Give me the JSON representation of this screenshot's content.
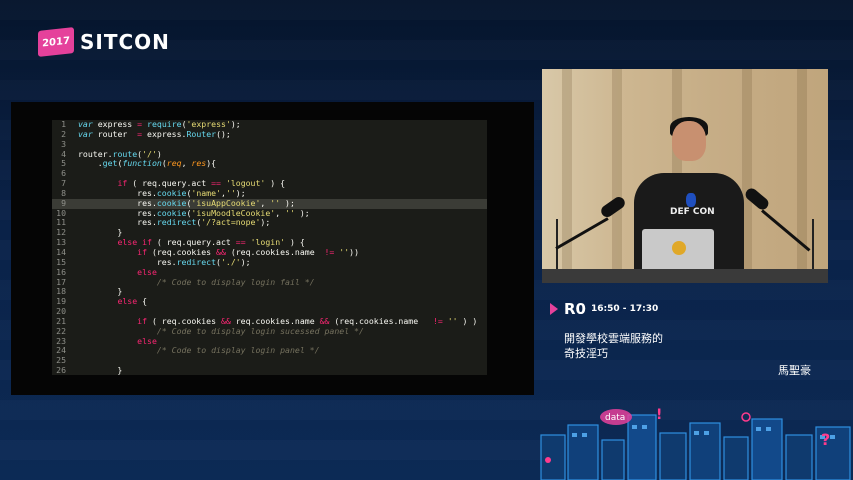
{
  "brand": {
    "year": "2017",
    "name": "SITCON"
  },
  "code": {
    "lines": [
      {
        "n": "1",
        "parts": [
          [
            "ky",
            "var"
          ],
          [
            "lt",
            " express "
          ],
          [
            "kw",
            "="
          ],
          [
            "lt",
            " "
          ],
          [
            "fn",
            "require"
          ],
          [
            "lt",
            "("
          ],
          [
            "st",
            "'express'"
          ],
          [
            "lt",
            ");"
          ]
        ]
      },
      {
        "n": "2",
        "parts": [
          [
            "ky",
            "var"
          ],
          [
            "lt",
            " router  "
          ],
          [
            "kw",
            "="
          ],
          [
            "lt",
            " express."
          ],
          [
            "fn",
            "Router"
          ],
          [
            "lt",
            "();"
          ]
        ]
      },
      {
        "n": "3",
        "parts": []
      },
      {
        "n": "4",
        "parts": [
          [
            "lt",
            "router."
          ],
          [
            "fn",
            "route"
          ],
          [
            "lt",
            "("
          ],
          [
            "st",
            "'/'"
          ],
          [
            "lt",
            ")"
          ]
        ]
      },
      {
        "n": "5",
        "parts": [
          [
            "lt",
            "    ."
          ],
          [
            "fn",
            "get"
          ],
          [
            "lt",
            "("
          ],
          [
            "ky",
            "function"
          ],
          [
            "lt",
            "("
          ],
          [
            "pa",
            "req"
          ],
          [
            "lt",
            ", "
          ],
          [
            "pa",
            "res"
          ],
          [
            "lt",
            "){"
          ]
        ]
      },
      {
        "n": "6",
        "parts": []
      },
      {
        "n": "7",
        "parts": [
          [
            "lt",
            "        "
          ],
          [
            "kw",
            "if"
          ],
          [
            "lt",
            " ( req.query.act "
          ],
          [
            "kw",
            "=="
          ],
          [
            "lt",
            " "
          ],
          [
            "st",
            "'logout'"
          ],
          [
            "lt",
            " ) {"
          ]
        ]
      },
      {
        "n": "8",
        "parts": [
          [
            "lt",
            "            res."
          ],
          [
            "fn",
            "cookie"
          ],
          [
            "lt",
            "("
          ],
          [
            "st",
            "'name'"
          ],
          [
            "lt",
            ","
          ],
          [
            "st",
            "''"
          ],
          [
            "lt",
            ");"
          ]
        ]
      },
      {
        "n": "9",
        "hl": true,
        "parts": [
          [
            "lt",
            "            res."
          ],
          [
            "fn",
            "cookie"
          ],
          [
            "lt",
            "("
          ],
          [
            "st",
            "'isuAppCookie'"
          ],
          [
            "lt",
            ", "
          ],
          [
            "st",
            "''"
          ],
          [
            "lt",
            " );"
          ]
        ]
      },
      {
        "n": "10",
        "parts": [
          [
            "lt",
            "            res."
          ],
          [
            "fn",
            "cookie"
          ],
          [
            "lt",
            "("
          ],
          [
            "st",
            "'isuMoodleCookie'"
          ],
          [
            "lt",
            ", "
          ],
          [
            "st",
            "''"
          ],
          [
            "lt",
            " );"
          ]
        ]
      },
      {
        "n": "11",
        "parts": [
          [
            "lt",
            "            res."
          ],
          [
            "fn",
            "redirect"
          ],
          [
            "lt",
            "("
          ],
          [
            "st",
            "'/?act=nope'"
          ],
          [
            "lt",
            ");"
          ]
        ]
      },
      {
        "n": "12",
        "parts": [
          [
            "lt",
            "        }"
          ]
        ]
      },
      {
        "n": "13",
        "parts": [
          [
            "lt",
            "        "
          ],
          [
            "kw",
            "else if"
          ],
          [
            "lt",
            " ( req.query.act "
          ],
          [
            "kw",
            "=="
          ],
          [
            "lt",
            " "
          ],
          [
            "st",
            "'login'"
          ],
          [
            "lt",
            " ) {"
          ]
        ]
      },
      {
        "n": "14",
        "parts": [
          [
            "lt",
            "            "
          ],
          [
            "kw",
            "if"
          ],
          [
            "lt",
            " (req.cookies "
          ],
          [
            "kw",
            "&&"
          ],
          [
            "lt",
            " (req.cookies.name  "
          ],
          [
            "kw",
            "!="
          ],
          [
            "lt",
            " "
          ],
          [
            "st",
            "''"
          ],
          [
            "lt",
            "))"
          ]
        ]
      },
      {
        "n": "15",
        "parts": [
          [
            "lt",
            "                res."
          ],
          [
            "fn",
            "redirect"
          ],
          [
            "lt",
            "("
          ],
          [
            "st",
            "'./'"
          ],
          [
            "lt",
            ");"
          ]
        ]
      },
      {
        "n": "16",
        "parts": [
          [
            "lt",
            "            "
          ],
          [
            "kw",
            "else"
          ]
        ]
      },
      {
        "n": "17",
        "parts": [
          [
            "lt",
            "                "
          ],
          [
            "cm",
            "/* Code to display login fail */"
          ]
        ]
      },
      {
        "n": "18",
        "parts": [
          [
            "lt",
            "        }"
          ]
        ]
      },
      {
        "n": "19",
        "parts": [
          [
            "lt",
            "        "
          ],
          [
            "kw",
            "else"
          ],
          [
            "lt",
            " {"
          ]
        ]
      },
      {
        "n": "20",
        "parts": []
      },
      {
        "n": "21",
        "parts": [
          [
            "lt",
            "            "
          ],
          [
            "kw",
            "if"
          ],
          [
            "lt",
            " ( req.cookies "
          ],
          [
            "kw",
            "&&"
          ],
          [
            "lt",
            " req.cookies.name "
          ],
          [
            "kw",
            "&&"
          ],
          [
            "lt",
            " (req.cookies.name   "
          ],
          [
            "kw",
            "!="
          ],
          [
            "lt",
            " "
          ],
          [
            "st",
            "''"
          ],
          [
            "lt",
            " ) )"
          ]
        ]
      },
      {
        "n": "22",
        "parts": [
          [
            "lt",
            "                "
          ],
          [
            "cm",
            "/* Code to display login sucessed panel */"
          ]
        ]
      },
      {
        "n": "23",
        "parts": [
          [
            "lt",
            "            "
          ],
          [
            "kw",
            "else"
          ]
        ]
      },
      {
        "n": "24",
        "parts": [
          [
            "lt",
            "                "
          ],
          [
            "cm",
            "/* Code to display login panel */"
          ]
        ]
      },
      {
        "n": "25",
        "parts": []
      },
      {
        "n": "26",
        "parts": [
          [
            "lt",
            "        }"
          ]
        ]
      }
    ]
  },
  "video": {
    "shirt_text": "DEF CON"
  },
  "session": {
    "room": "R0",
    "time": "16:50 - 17:30",
    "title_line1": "開發學校雲端服務的",
    "title_line2": "奇技淫巧",
    "speaker": "馬聖豪"
  },
  "decor": {
    "city_sign": "data"
  }
}
